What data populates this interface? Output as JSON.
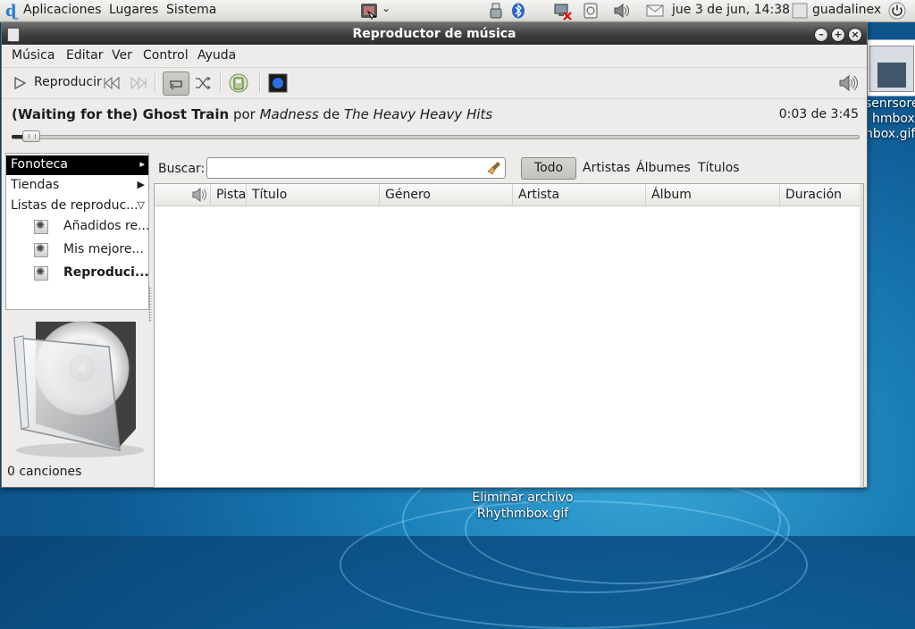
{
  "panel": {
    "menus": [
      "Aplicaciones",
      "Lugares",
      "Sistema"
    ],
    "clock": "jue  3 de jun, 14:38",
    "user": "guadalinex"
  },
  "desktop": {
    "file_label": "Eliminar archivo\nRhythmbox.gif",
    "right_labels": [
      "senrsore",
      "hmbox.g",
      "nbox.gif"
    ]
  },
  "window": {
    "title": "Reproductor de música",
    "menu": [
      "Música",
      "Editar",
      "Ver",
      "Control",
      "Ayuda"
    ],
    "toolbar": {
      "play_label": "Reproducir"
    },
    "now_playing": {
      "song": "(Waiting for the) Ghost Train",
      "by_word": "por",
      "artist": "Madness",
      "of_word": "de",
      "album": "The Heavy Heavy Hits"
    },
    "time_position": "0:03 de 3:45",
    "seek_fraction": 0.013,
    "sidebar": {
      "sources": [
        {
          "label": "Fonoteca",
          "selected": true
        },
        {
          "label": "Tiendas"
        },
        {
          "label": "Listas de reproduc..."
        }
      ],
      "playlists": [
        "Añadidos re...",
        "Mis mejore...",
        "Reproduci..."
      ]
    },
    "search": {
      "label": "Buscar:",
      "value": ""
    },
    "filters": [
      "Todo",
      "Artistas",
      "Álbumes",
      "Títulos"
    ],
    "columns": [
      "Pista",
      "Título",
      "Género",
      "Artista",
      "Álbum",
      "Duración"
    ],
    "status": "0 canciones"
  },
  "colors": {
    "titlebar": "#3d3d3d",
    "selection": "#000000",
    "desktop": "#1a7db7"
  }
}
